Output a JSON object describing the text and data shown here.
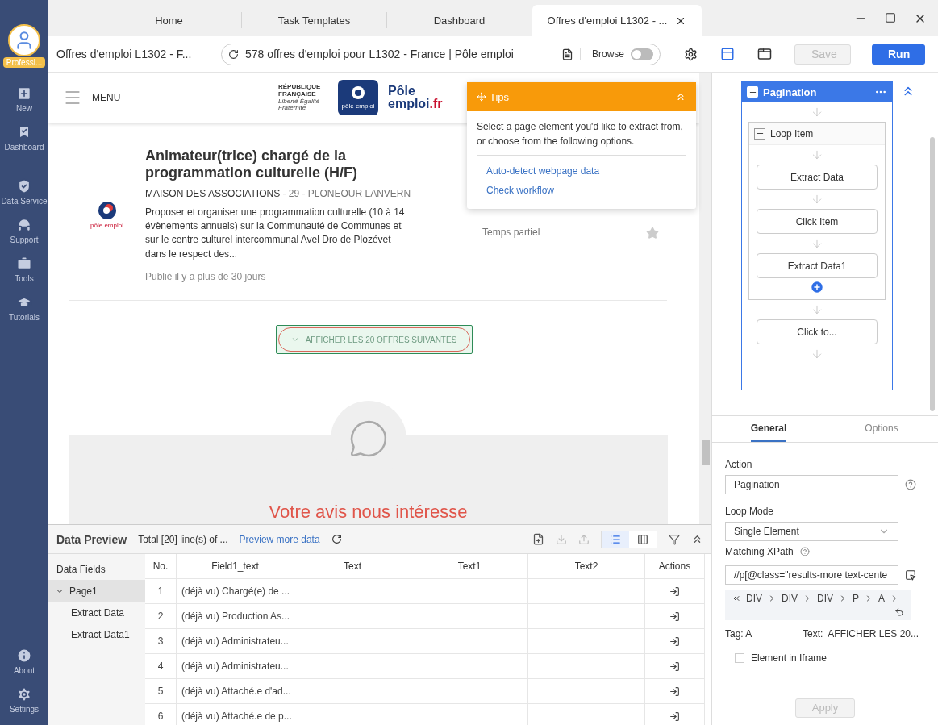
{
  "sidebar": {
    "avatar_badge": "Professi...",
    "items": [
      {
        "label": "New",
        "kind": "new"
      },
      {
        "label": "Dashboard",
        "kind": "dashboard"
      },
      {
        "label": "Data Service",
        "kind": "service"
      },
      {
        "label": "Support",
        "kind": "support"
      },
      {
        "label": "Tools",
        "kind": "tools"
      },
      {
        "label": "Tutorials",
        "kind": "tutorials"
      }
    ],
    "bottom_items": [
      {
        "label": "About",
        "kind": "about"
      },
      {
        "label": "Settings",
        "kind": "settings"
      }
    ]
  },
  "tabs": [
    {
      "label": "Home",
      "selected": false,
      "closable": false
    },
    {
      "label": "Task Templates",
      "selected": false,
      "closable": false
    },
    {
      "label": "Dashboard",
      "selected": false,
      "closable": false
    },
    {
      "label": "Offres d'emploi L1302 - ...",
      "selected": true,
      "closable": true
    }
  ],
  "toolbar": {
    "task_name": "Offres d'emploi L1302 - F...",
    "url": "578 offres d'emploi pour L1302 - France | Pôle emploi",
    "browse_label": "Browse",
    "browse_on": false,
    "save": {
      "label": "Save",
      "disabled": true
    },
    "run": {
      "label": "Run",
      "disabled": false
    }
  },
  "webpage": {
    "menu_label": "MENU",
    "republique": "RÉPUBLIQUE FRANÇAISE",
    "motto": "Liberté Égalité Fraternité",
    "brand_top": "Pôle",
    "brand_bottom": "emploi",
    "brand_suffix": ".fr",
    "brand_small": "pôle emploi",
    "job": {
      "title": "Animateur(trice) chargé de la programmation culturelle (H/F)",
      "company": "MAISON DES ASSOCIATIONS",
      "location": " - 29 - PLONEOUR LANVERN",
      "description": "Proposer et organiser une programmation culturelle (10 à 14 évènements annuels) sur la Communauté de Communes et sur le centre culturel intercommunal Avel Dro de Plozévet dans le respect des...",
      "published": "Publié il y a plus de 30 jours",
      "contract": "Temps partiel",
      "logo_text": "pôle emploi"
    },
    "more_button": {
      "label": "AFFICHER LES 20 OFFRES SUIVANTES",
      "selected": true
    },
    "feedback_title": "Votre avis nous intéresse"
  },
  "tips": {
    "title": "Tips",
    "text": "Select a page element you'd like to extract from, or choose from the following options.",
    "links": [
      "Auto-detect webpage data",
      "Check workflow"
    ]
  },
  "workflow": {
    "loop": {
      "title": "Pagination",
      "expanded": true,
      "inner": {
        "title": "Loop Item",
        "expanded": true,
        "steps": [
          "Extract Data",
          "Click Item",
          "Extract Data1"
        ]
      },
      "after": [
        "Click to..."
      ]
    }
  },
  "properties": {
    "tabs": [
      {
        "label": "General",
        "selected": true
      },
      {
        "label": "Options",
        "selected": false
      }
    ],
    "action_label": "Action",
    "action_value": "Pagination",
    "loop_mode_label": "Loop Mode",
    "loop_mode_value": "Single Element",
    "xpath_label": "Matching XPath",
    "xpath_value": "//p[@class=\"results-more text-cente",
    "path": [
      "DIV",
      "DIV",
      "DIV",
      "P",
      "A"
    ],
    "tag": "Tag: A",
    "text": "Text:  AFFICHER LES 20...",
    "iframe_label": "Element in Iframe",
    "iframe_checked": false,
    "apply": {
      "label": "Apply",
      "disabled": true
    }
  },
  "data_preview": {
    "title": "Data Preview",
    "total": "Total [20] line(s) of ...",
    "more_link": "Preview more data",
    "views": [
      {
        "kind": "list",
        "selected": true
      },
      {
        "kind": "columns",
        "selected": false
      }
    ],
    "fields_title": "Data Fields",
    "fields": [
      {
        "label": "Page1",
        "selected": true,
        "expanded": true,
        "children": [
          {
            "label": "Extract Data",
            "selected": false
          },
          {
            "label": "Extract Data1",
            "selected": false
          }
        ]
      }
    ],
    "columns": [
      "No.",
      "Field1_text",
      "Text",
      "Text1",
      "Text2",
      "Actions"
    ],
    "rows": [
      [
        "1",
        "(déjà vu) Chargé(e) de ...",
        "",
        "",
        ""
      ],
      [
        "2",
        "(déjà vu) Production As...",
        "",
        "",
        ""
      ],
      [
        "3",
        "(déjà vu) Administrateu...",
        "",
        "",
        ""
      ],
      [
        "4",
        "(déjà vu) Administrateu...",
        "",
        "",
        ""
      ],
      [
        "5",
        "(déjà vu) Attaché.e d'ad...",
        "",
        "",
        ""
      ],
      [
        "6",
        "(déjà vu) Attaché.e de p...",
        "",
        "",
        ""
      ]
    ]
  }
}
